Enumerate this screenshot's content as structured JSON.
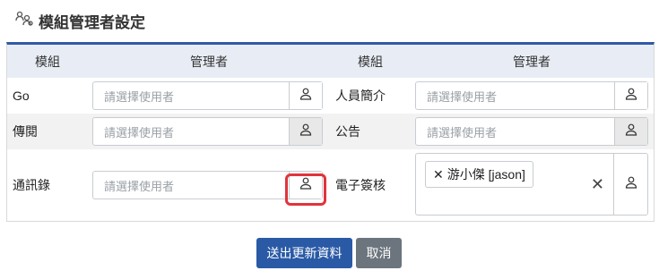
{
  "page": {
    "title": "模組管理者設定"
  },
  "table": {
    "headers": [
      "模組",
      "管理者",
      "模組",
      "管理者"
    ],
    "rows": [
      {
        "left_module": "Go",
        "left_placeholder": "請選擇使用者",
        "right_module": "人員簡介",
        "right_placeholder": "請選擇使用者"
      },
      {
        "left_module": "傳閱",
        "left_placeholder": "請選擇使用者",
        "right_module": "公告",
        "right_placeholder": "請選擇使用者"
      },
      {
        "left_module": "通訊錄",
        "left_placeholder": "請選擇使用者",
        "right_module": "電子簽核",
        "right_tag": "游小傑 [jason]"
      }
    ]
  },
  "actions": {
    "submit": "送出更新資料",
    "cancel": "取消"
  },
  "colors": {
    "accent": "#2f5aa8",
    "highlight": "#e0343b",
    "secondary": "#6c757d"
  },
  "icons": {
    "title": "users-settings-icon",
    "picker": "user-icon",
    "remove": "close-icon"
  }
}
